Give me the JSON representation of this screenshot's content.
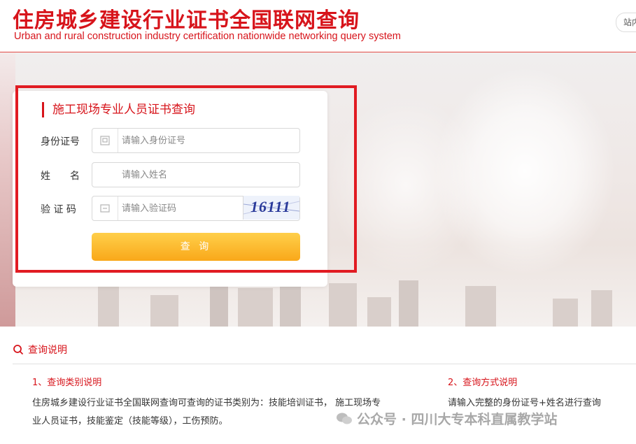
{
  "header": {
    "title_cn": "住房城乡建设行业证书全国联网查询",
    "title_en": "Urban and rural construction industry certification nationwide networking query system",
    "site_button": "站内"
  },
  "form": {
    "title": "施工现场专业人员证书查询",
    "id_label": "身份证号",
    "id_placeholder": "请输入身份证号",
    "name_label": "姓　　名",
    "name_placeholder": "请输入姓名",
    "captcha_label": "验 证 码",
    "captcha_placeholder": "请输入验证码",
    "captcha_text": "16111",
    "submit_label": "查 询"
  },
  "info": {
    "heading": "查询说明",
    "sec1_title": "1、查询类别说明",
    "sec1_body": "住房城乡建设行业证书全国联网查询可查询的证书类别为：技能培训证书， 施工现场专业人员证书，技能鉴定（技能等级），工伤预防。",
    "sec2_title": "2、查询方式说明",
    "sec2_body": "请输入完整的身份证号+姓名进行查询"
  },
  "watermark": "公众号 · 四川大专本科直属教学站",
  "colors": {
    "brand_red": "#d7141b",
    "highlight_frame": "#e11b22",
    "button_orange": "#f9a81a"
  }
}
